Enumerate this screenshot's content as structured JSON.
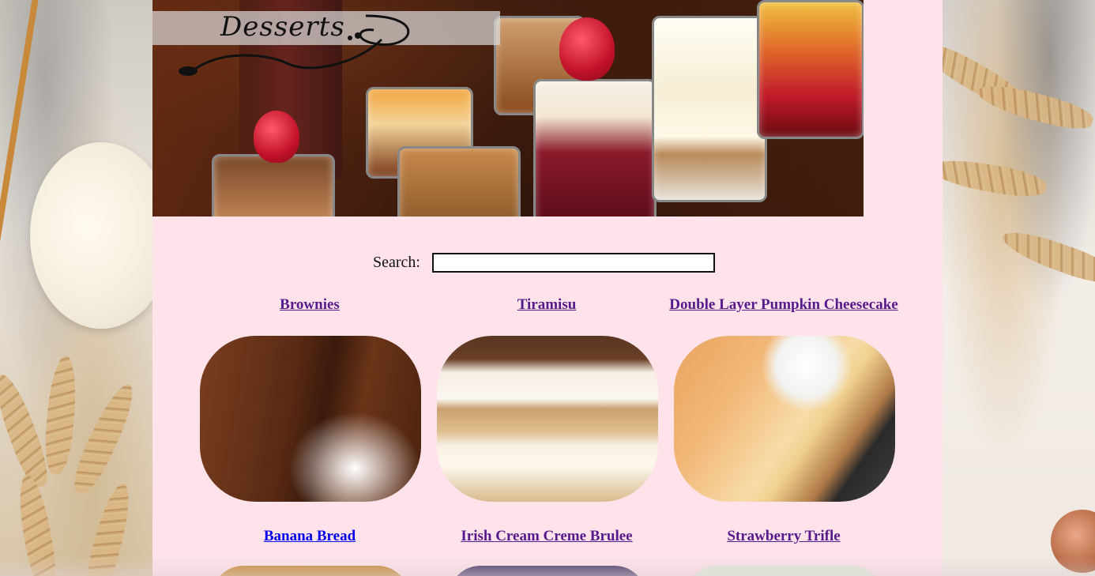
{
  "banner": {
    "title": "Desserts"
  },
  "search": {
    "label": "Search:",
    "value": "",
    "placeholder": ""
  },
  "desserts": [
    {
      "label": "Brownies",
      "visited": true
    },
    {
      "label": "Tiramisu",
      "visited": true
    },
    {
      "label": "Double Layer Pumpkin Cheesecake",
      "visited": true
    },
    {
      "label": "Banana Bread",
      "visited": false
    },
    {
      "label": "Irish Cream Creme Brulee",
      "visited": true
    },
    {
      "label": "Strawberry Trifle",
      "visited": true
    }
  ],
  "colors": {
    "page_background": "#ffe2ea",
    "link_visited": "#551a8b",
    "link_unvisited": "#0000ee"
  }
}
